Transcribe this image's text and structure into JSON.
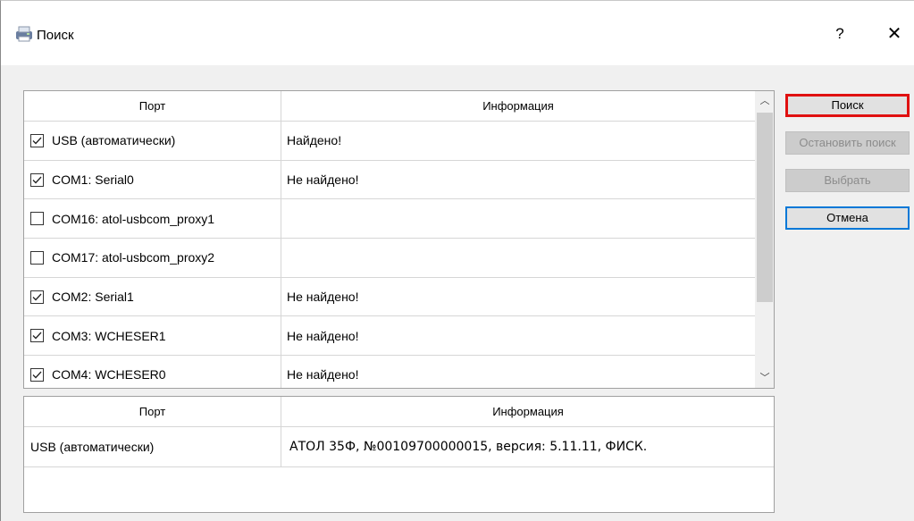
{
  "window": {
    "title": "Поиск",
    "help_label": "?",
    "close_label": "✕"
  },
  "buttons": {
    "search": "Поиск",
    "stop": "Остановить поиск",
    "select": "Выбрать",
    "cancel": "Отмена"
  },
  "ports_table": {
    "headers": [
      "Порт",
      "Информация"
    ],
    "rows": [
      {
        "port": "USB (автоматически)",
        "checked": true,
        "info": "Найдено!"
      },
      {
        "port": "COM1: Serial0",
        "checked": true,
        "info": "Не найдено!"
      },
      {
        "port": "COM16: atol-usbcom_proxy1",
        "checked": false,
        "info": ""
      },
      {
        "port": "COM17: atol-usbcom_proxy2",
        "checked": false,
        "info": ""
      },
      {
        "port": "COM2: Serial1",
        "checked": true,
        "info": "Не найдено!"
      },
      {
        "port": "COM3: WCHESER1",
        "checked": true,
        "info": "Не найдено!"
      },
      {
        "port": "COM4: WCHESER0",
        "checked": true,
        "info": "Не найдено!"
      }
    ]
  },
  "results_table": {
    "headers": [
      "Порт",
      "Информация"
    ],
    "rows": [
      {
        "port": "USB (автоматически)",
        "info": "АТОЛ 35Ф, №00109700000015, версия: 5.11.11, ФИСК."
      }
    ]
  },
  "icons": {
    "window_icon": "printer-icon",
    "scroll_up": "chevron-up-icon",
    "scroll_down": "chevron-down-icon",
    "checkbox": "checkmark-icon"
  },
  "colors": {
    "focus_red": "#e01010",
    "default_blue": "#0078d7",
    "disabled_text": "#8c8c8c"
  }
}
